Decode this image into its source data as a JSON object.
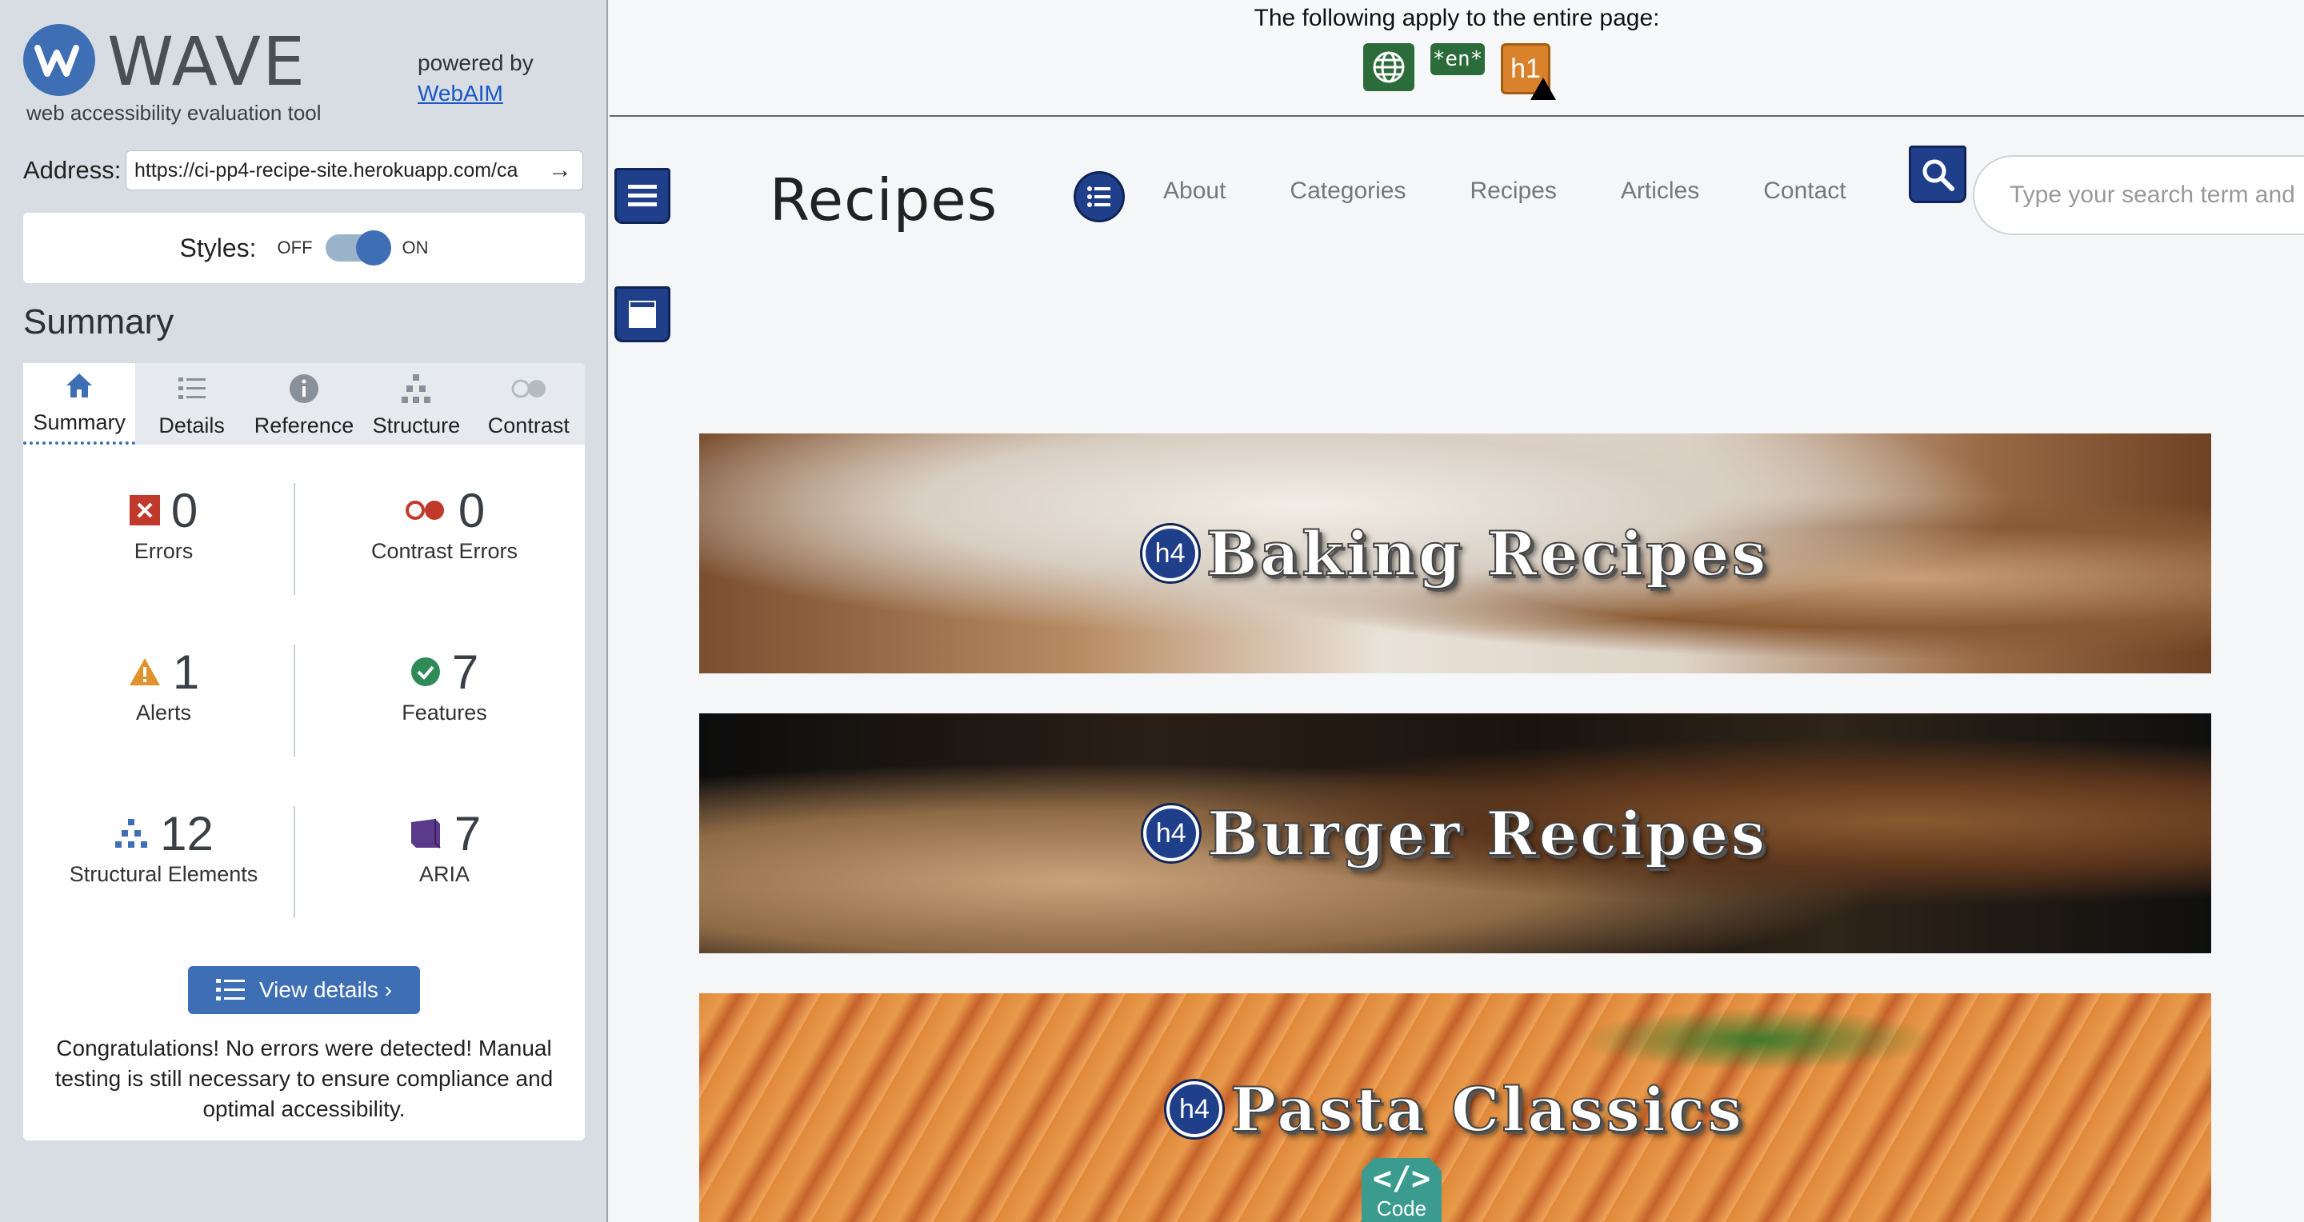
{
  "wave": {
    "logo_text": "WAVE",
    "tagline": "web accessibility evaluation tool",
    "powered_by": "powered by",
    "webaim_link": "WebAIM",
    "address_label": "Address:",
    "address_value": "https://ci-pp4-recipe-site.herokuapp.com/ca",
    "styles_label": "Styles:",
    "styles_off": "OFF",
    "styles_on": "ON",
    "summary_title": "Summary",
    "tabs": [
      {
        "label": "Summary",
        "icon": "home-icon",
        "active": true
      },
      {
        "label": "Details",
        "icon": "list-icon"
      },
      {
        "label": "Reference",
        "icon": "info-icon"
      },
      {
        "label": "Structure",
        "icon": "structure-icon"
      },
      {
        "label": "Contrast",
        "icon": "contrast-icon"
      }
    ],
    "stats": {
      "errors": {
        "value": "0",
        "label": "Errors"
      },
      "contrast_errors": {
        "value": "0",
        "label": "Contrast Errors"
      },
      "alerts": {
        "value": "1",
        "label": "Alerts"
      },
      "features": {
        "value": "7",
        "label": "Features"
      },
      "structural": {
        "value": "12",
        "label": "Structural Elements"
      },
      "aria": {
        "value": "7",
        "label": "ARIA"
      }
    },
    "view_details": "View details ›",
    "congrats": "Congratulations! No errors were detected! Manual testing is still necessary to ensure compliance and optimal accessibility."
  },
  "page": {
    "notice": "The following apply to the entire page:",
    "lang_badge": "*en*",
    "h1_badge": "h1",
    "brand": "Recipes",
    "nav": [
      "About",
      "Categories",
      "Recipes",
      "Articles",
      "Contact"
    ],
    "search_placeholder": "Type your search term and",
    "h4_badge": "h4",
    "banners": [
      "Baking Recipes",
      "Burger Recipes",
      "Pasta Classics"
    ],
    "code_symbol": "</>",
    "code_label": "Code"
  },
  "colors": {
    "wave_blue": "#3e6fb5",
    "landmark_navy": "#1f3f8a",
    "error_red": "#c0392b",
    "alert_orange": "#e0922f",
    "feature_green": "#2e8b57",
    "aria_purple": "#5a3a8a",
    "code_teal": "#3b9b8e"
  }
}
